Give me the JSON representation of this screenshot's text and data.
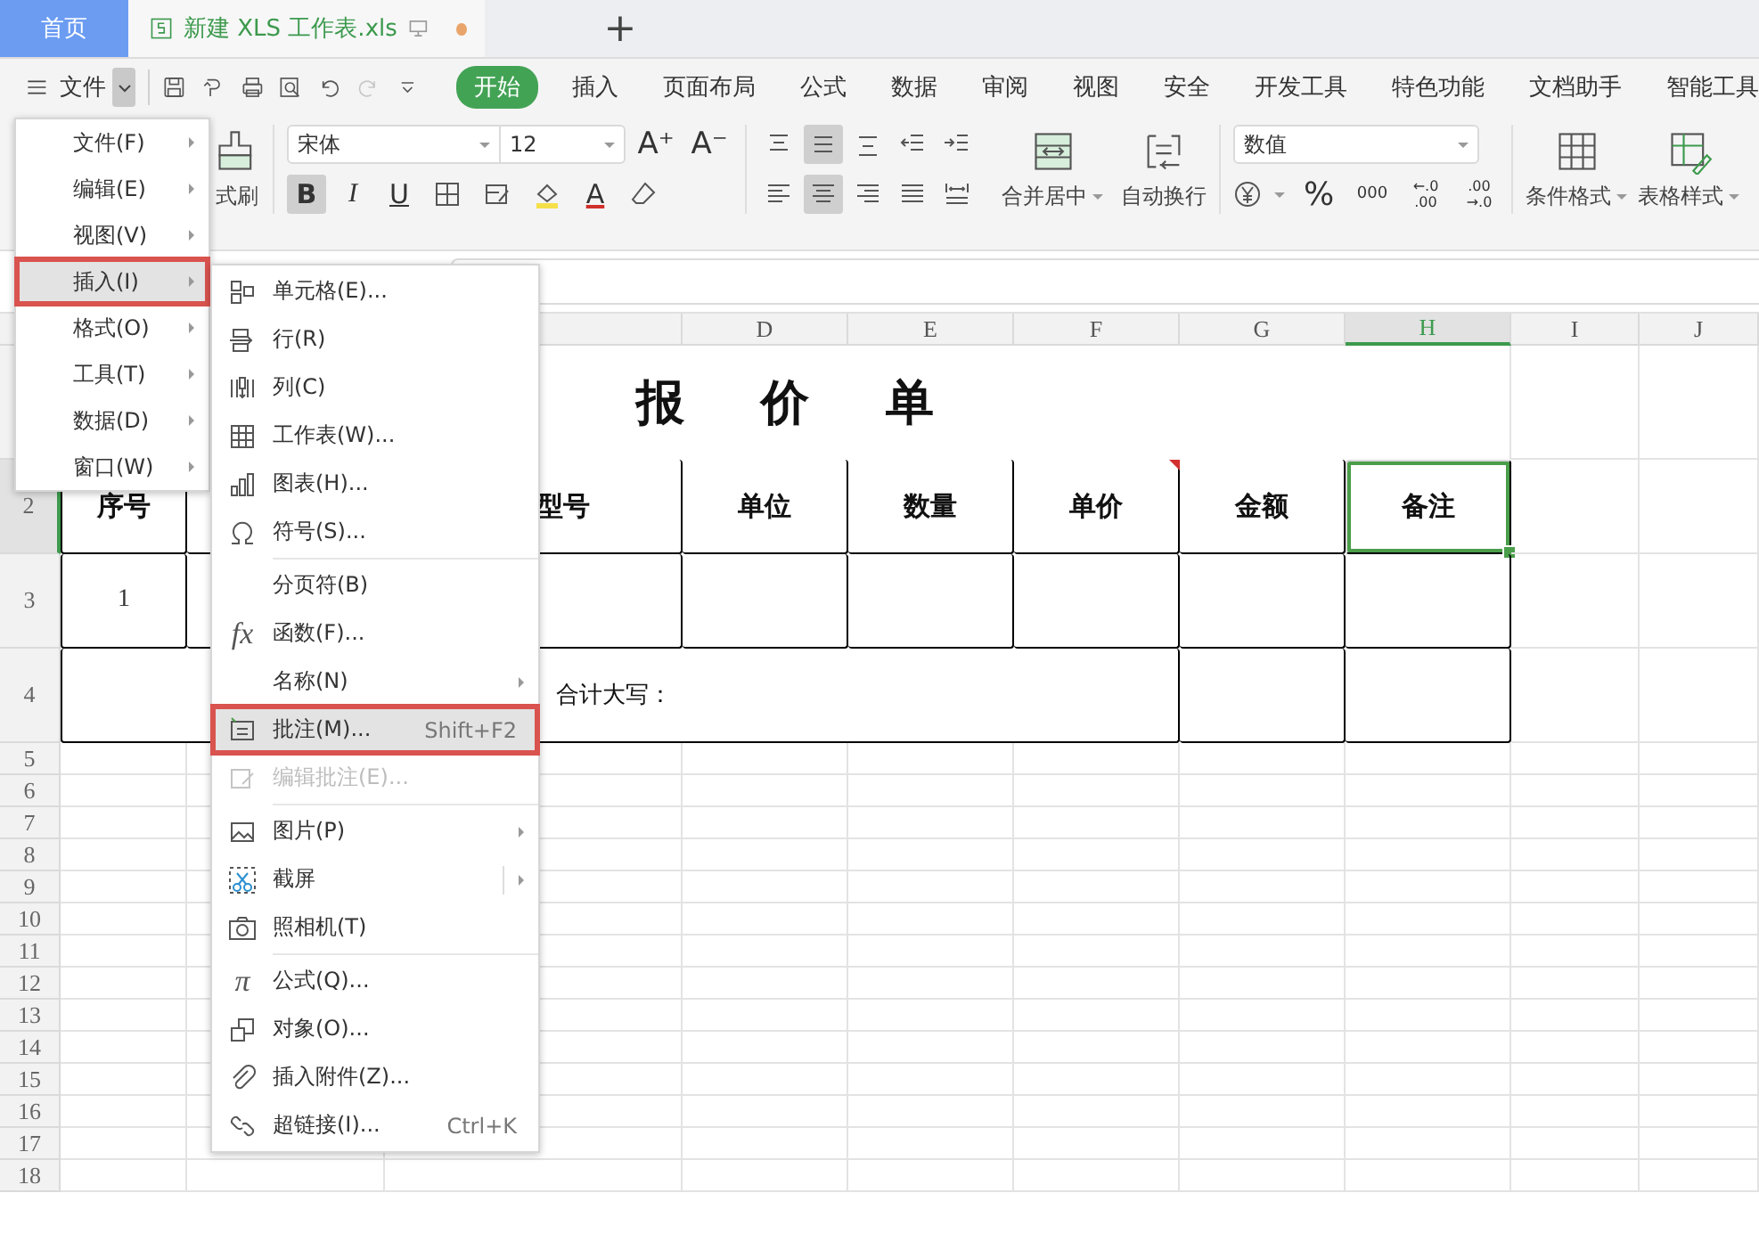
{
  "tabs": [
    {
      "label": "首页",
      "selected": false
    },
    {
      "label": "新建 XLS 工作表.xls",
      "selected": true,
      "unsaved": true
    }
  ],
  "new_tab": "+",
  "menu_button": {
    "label": "文件"
  },
  "ribbon_tabs": [
    {
      "label": "开始",
      "selected": true
    },
    {
      "label": "插入",
      "selected": false
    },
    {
      "label": "页面布局",
      "selected": false
    },
    {
      "label": "公式",
      "selected": false
    },
    {
      "label": "数据",
      "selected": false
    },
    {
      "label": "审阅",
      "selected": false
    },
    {
      "label": "视图",
      "selected": false
    },
    {
      "label": "安全",
      "selected": false
    },
    {
      "label": "开发工具",
      "selected": false
    },
    {
      "label": "特色功能",
      "selected": false
    },
    {
      "label": "文档助手",
      "selected": false
    },
    {
      "label": "智能工具",
      "selected": false
    }
  ],
  "toolbar": {
    "format_painter": "式刷",
    "font": "宋体",
    "font_size": "12",
    "grow_font": "A⁺",
    "shrink_font": "A⁻",
    "styles": [
      {
        "label": "B",
        "selected": true
      },
      {
        "label": "I",
        "selected": false
      },
      {
        "label": "U",
        "selected": false
      }
    ],
    "font_color": "A",
    "alignment": [
      {
        "selected": false
      },
      {
        "selected": true
      },
      {
        "selected": false
      },
      {
        "selected": false
      },
      {
        "selected": false
      },
      {
        "selected": false
      },
      {
        "selected": true
      },
      {
        "selected": false
      },
      {
        "selected": false
      },
      {
        "selected": false
      }
    ],
    "merge": "合并居中",
    "wrap": "自动换行",
    "number_format": "数值",
    "percent": "%",
    "thousands": "000",
    "decimals": [
      [
        "←.0",
        ".00"
      ],
      [
        ".00",
        "→.0"
      ]
    ],
    "conditional": "条件格式",
    "table_style": "表格样式"
  },
  "sheet": {
    "column_headers": [
      {
        "label": "D",
        "selected": false
      },
      {
        "label": "E",
        "selected": false
      },
      {
        "label": "F",
        "selected": false
      },
      {
        "label": "G",
        "selected": false
      },
      {
        "label": "H",
        "selected": true
      },
      {
        "label": "I",
        "selected": false
      },
      {
        "label": "J",
        "selected": false
      }
    ],
    "row_headers": [
      {
        "label": "2",
        "selected": true
      },
      {
        "label": "3",
        "selected": false
      },
      {
        "label": "4",
        "selected": false
      },
      {
        "label": "5",
        "selected": false
      },
      {
        "label": "6",
        "selected": false
      },
      {
        "label": "7",
        "selected": false
      },
      {
        "label": "8",
        "selected": false
      },
      {
        "label": "9",
        "selected": false
      },
      {
        "label": "10",
        "selected": false
      },
      {
        "label": "11",
        "selected": false
      },
      {
        "label": "12",
        "selected": false
      },
      {
        "label": "13",
        "selected": false
      },
      {
        "label": "14",
        "selected": false
      },
      {
        "label": "15",
        "selected": false
      },
      {
        "label": "16",
        "selected": false
      },
      {
        "label": "17",
        "selected": false
      },
      {
        "label": "18",
        "selected": false
      }
    ],
    "title": "报价单",
    "header_cells": [
      {
        "text": "序号",
        "selected": false
      },
      {
        "text": "型号",
        "selected": false
      },
      {
        "text": "单位",
        "selected": false
      },
      {
        "text": "数量",
        "selected": false
      },
      {
        "text": "单价",
        "selected": false,
        "comment": true
      },
      {
        "text": "金额",
        "selected": false
      },
      {
        "text": "备注",
        "selected": true
      }
    ],
    "row3_first": "1",
    "total_label": "合计大写："
  },
  "main_menu": [
    {
      "label": "文件(F)",
      "selected": false
    },
    {
      "label": "编辑(E)",
      "selected": false
    },
    {
      "label": "视图(V)",
      "selected": false
    },
    {
      "label": "插入(I)",
      "selected": true
    },
    {
      "label": "格式(O)",
      "selected": false
    },
    {
      "label": "工具(T)",
      "selected": false
    },
    {
      "label": "数据(D)",
      "selected": false
    },
    {
      "label": "窗口(W)",
      "selected": false
    }
  ],
  "submenu": [
    {
      "label": "单元格(E)...",
      "selected": false,
      "disabled": false
    },
    {
      "label": "行(R)",
      "selected": false,
      "disabled": false
    },
    {
      "label": "列(C)",
      "selected": false,
      "disabled": false
    },
    {
      "label": "工作表(W)...",
      "selected": false,
      "disabled": false
    },
    {
      "label": "图表(H)...",
      "selected": false,
      "disabled": false
    },
    {
      "label": "符号(S)...",
      "selected": false,
      "disabled": false,
      "separator_after": true
    },
    {
      "label": "分页符(B)",
      "selected": false,
      "disabled": false
    },
    {
      "label": "函数(F)...",
      "selected": false,
      "disabled": false,
      "icon_text": "fx"
    },
    {
      "label": "名称(N)",
      "selected": false,
      "disabled": false,
      "has_submenu": true
    },
    {
      "label": "批注(M)...",
      "selected": true,
      "disabled": false,
      "shortcut": "Shift+F2"
    },
    {
      "label": "编辑批注(E)...",
      "selected": false,
      "disabled": true,
      "separator_after": true
    },
    {
      "label": "图片(P)",
      "selected": false,
      "disabled": false,
      "has_submenu": true
    },
    {
      "label": "截屏",
      "selected": false,
      "disabled": false,
      "has_submenu": true,
      "split": true
    },
    {
      "label": "照相机(T)",
      "selected": false,
      "disabled": false,
      "separator_after": true
    },
    {
      "label": "公式(Q)...",
      "selected": false,
      "disabled": false,
      "icon_text": "π"
    },
    {
      "label": "对象(O)...",
      "selected": false,
      "disabled": false
    },
    {
      "label": "插入附件(Z)...",
      "selected": false,
      "disabled": false
    },
    {
      "label": "超链接(I)...",
      "selected": false,
      "disabled": false,
      "shortcut": "Ctrl+K"
    }
  ]
}
